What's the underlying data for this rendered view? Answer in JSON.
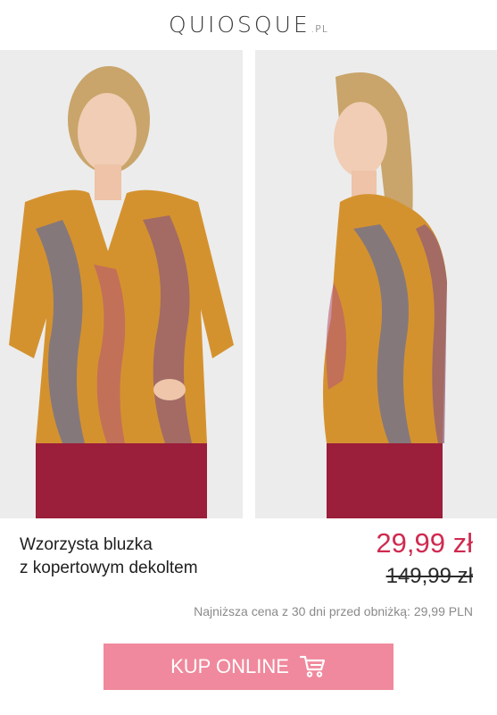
{
  "header": {
    "logo": "QUIOSQUE",
    "logo_tld": ".PL"
  },
  "product": {
    "title_line1": "Wzorzysta bluzka",
    "title_line2": "z kopertowym dekoltem",
    "price_current": "29,99 zł",
    "price_old": "149,99 zł",
    "lowest_price_note": "Najniższa cena z 30 dni przed obniżką: 29,99 PLN"
  },
  "cta": {
    "label": "KUP ONLINE",
    "icon": "shopping-cart-icon"
  },
  "images": [
    {
      "name": "model-front-photo",
      "description": "front view"
    },
    {
      "name": "model-side-photo",
      "description": "side view"
    }
  ],
  "colors": {
    "price": "#cf2a50",
    "button": "#f0899d",
    "blouse": "#d4922f",
    "skirt": "#9b1e3a"
  }
}
